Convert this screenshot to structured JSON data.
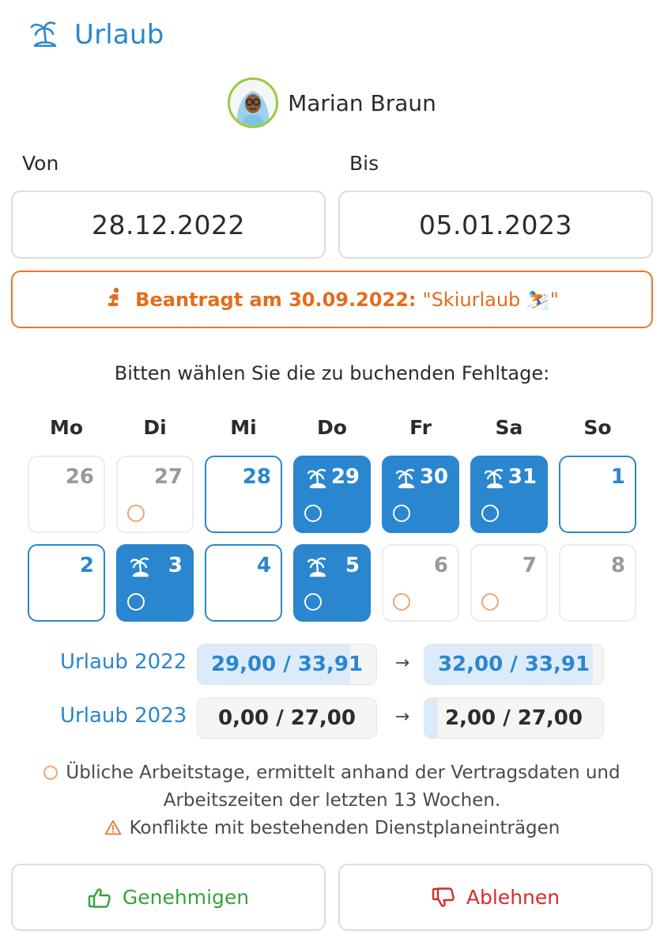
{
  "header": {
    "title": "Urlaub",
    "icon": "palm-island-icon"
  },
  "user": {
    "name": "Marian Braun"
  },
  "from": {
    "label": "Von",
    "value": "28.12.2022"
  },
  "to": {
    "label": "Bis",
    "value": "05.01.2023"
  },
  "request": {
    "prefix": "Beantragt am 30.09.2022:",
    "note": "\"Skiurlaub ⛷️\""
  },
  "prompt": "Bitten wählen Sie die zu buchenden Fehltage:",
  "weekdays": [
    "Mo",
    "Di",
    "Mi",
    "Do",
    "Fr",
    "Sa",
    "So"
  ],
  "days": [
    {
      "num": "26",
      "state": "disabled",
      "usual": false
    },
    {
      "num": "27",
      "state": "disabled",
      "usual": true
    },
    {
      "num": "28",
      "state": "outline",
      "usual": false
    },
    {
      "num": "29",
      "state": "selected",
      "usual": true
    },
    {
      "num": "30",
      "state": "selected",
      "usual": true
    },
    {
      "num": "31",
      "state": "selected",
      "usual": true
    },
    {
      "num": "1",
      "state": "outline",
      "usual": false
    },
    {
      "num": "2",
      "state": "outline",
      "usual": false
    },
    {
      "num": "3",
      "state": "selected",
      "usual": true
    },
    {
      "num": "4",
      "state": "outline",
      "usual": false
    },
    {
      "num": "5",
      "state": "selected",
      "usual": true
    },
    {
      "num": "6",
      "state": "disabled",
      "usual": true
    },
    {
      "num": "7",
      "state": "disabled",
      "usual": true
    },
    {
      "num": "8",
      "state": "disabled",
      "usual": false
    }
  ],
  "balances": [
    {
      "label": "Urlaub 2022",
      "before": "29,00 / 33,91",
      "after": "32,00 / 33,91",
      "before_fraction": 0.855,
      "after_fraction": 0.944
    },
    {
      "label": "Urlaub 2023",
      "before": "0,00 / 27,00",
      "after": "2,00 / 27,00",
      "before_fraction": 0.0,
      "after_fraction": 0.074
    }
  ],
  "arrow": "→",
  "legend": {
    "usual_line1": "Übliche Arbeitstage, ermittelt anhand der Vertragsdaten und",
    "usual_line2": "Arbeitszeiten der letzten 13 Wochen.",
    "conflict": "Konflikte mit bestehenden Dienstplaneinträgen"
  },
  "buttons": {
    "approve": "Genehmigen",
    "reject": "Ablehnen"
  },
  "colors": {
    "accent": "#2a86cf",
    "warning": "#e8772a",
    "approve": "#35a33c",
    "reject": "#d72b2b"
  }
}
